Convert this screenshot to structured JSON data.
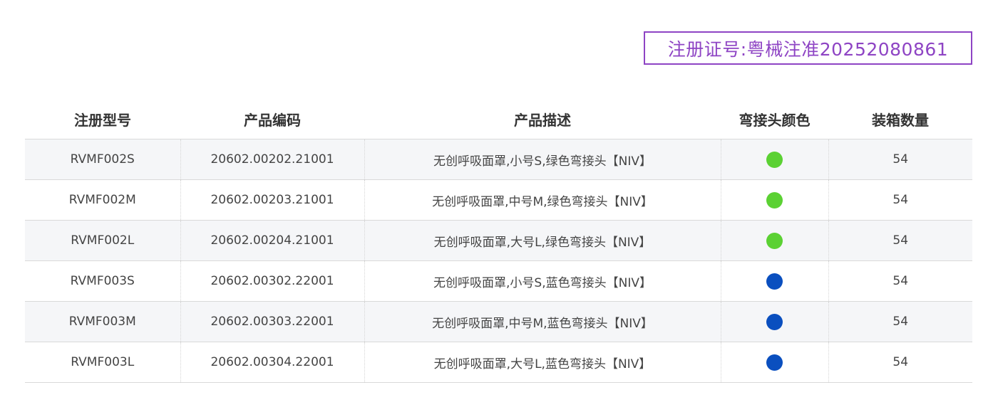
{
  "registration": {
    "text": "注册证号:粤械注准20252080861"
  },
  "table": {
    "headers": [
      "注册型号",
      "产品编码",
      "产品描述",
      "弯接头颜色",
      "装箱数量"
    ],
    "rows": [
      {
        "model": "RVMF002S",
        "code": "20602.00202.21001",
        "description": "无创呼吸面罩,小号S,绿色弯接头【NIV】",
        "connector_color": "green",
        "color_hex": "#5bd133",
        "quantity": "54"
      },
      {
        "model": "RVMF002M",
        "code": "20602.00203.21001",
        "description": "无创呼吸面罩,中号M,绿色弯接头【NIV】",
        "connector_color": "green",
        "color_hex": "#5bd133",
        "quantity": "54"
      },
      {
        "model": "RVMF002L",
        "code": "20602.00204.21001",
        "description": "无创呼吸面罩,大号L,绿色弯接头【NIV】",
        "connector_color": "green",
        "color_hex": "#5bd133",
        "quantity": "54"
      },
      {
        "model": "RVMF003S",
        "code": "20602.00302.22001",
        "description": "无创呼吸面罩,小号S,蓝色弯接头【NIV】",
        "connector_color": "blue",
        "color_hex": "#0a4fbf",
        "quantity": "54"
      },
      {
        "model": "RVMF003M",
        "code": "20602.00303.22001",
        "description": "无创呼吸面罩,中号M,蓝色弯接头【NIV】",
        "connector_color": "blue",
        "color_hex": "#0a4fbf",
        "quantity": "54"
      },
      {
        "model": "RVMF003L",
        "code": "20602.00304.22001",
        "description": "无创呼吸面罩,大号L,蓝色弯接头【NIV】",
        "connector_color": "blue",
        "color_hex": "#0a4fbf",
        "quantity": "54"
      }
    ]
  },
  "colors": {
    "accent_purple": "#8e44c4",
    "row_stripe": "#f5f6f8",
    "green_connector": "#5bd133",
    "blue_connector": "#0a4fbf"
  }
}
